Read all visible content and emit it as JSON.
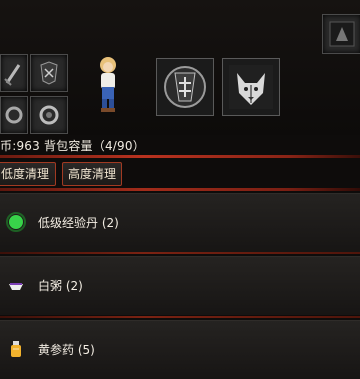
{
  "info": {
    "currency_line": "币:963 背包容量（4/90）"
  },
  "sort_buttons": [
    {
      "label": "低度清理"
    },
    {
      "label": "高度清理"
    }
  ],
  "items": [
    {
      "name": "低级经验丹",
      "count_text": "(2)",
      "label": "低级经验丹 (2)",
      "icon": "green-orb-icon"
    },
    {
      "name": "白粥",
      "count_text": "(2)",
      "label": "白粥 (2)",
      "icon": "porridge-bowl-icon"
    },
    {
      "name": "黄参药",
      "count_text": "(5)",
      "label": "黄参药 (5)",
      "icon": "potion-bottle-icon"
    }
  ],
  "colors": {
    "accent_red": "#b9321f",
    "button_border": "#a13a22",
    "background": "#0e0c0b"
  }
}
